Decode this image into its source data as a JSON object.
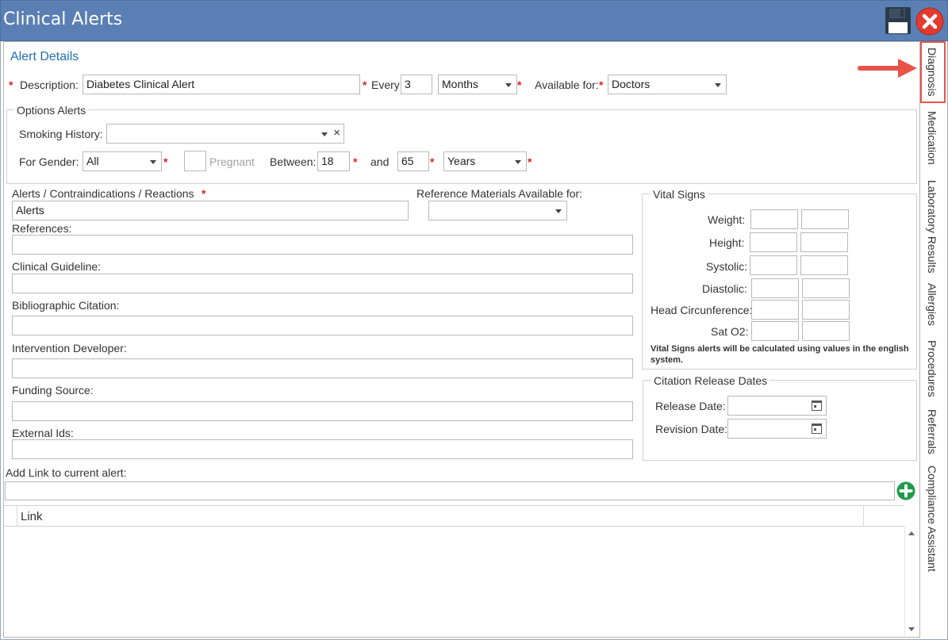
{
  "window": {
    "title": "Clinical Alerts"
  },
  "toolbar": {
    "save_icon": "floppy-disk-icon",
    "close_icon": "red-x-close-icon"
  },
  "side_tabs": [
    {
      "label": "Diagnosis",
      "active": true
    },
    {
      "label": "Medication"
    },
    {
      "label": "Laboratory Results"
    },
    {
      "label": "Allergies"
    },
    {
      "label": "Procedures"
    },
    {
      "label": "Referrals"
    },
    {
      "label": "Compliance Assistant"
    }
  ],
  "alert_details": {
    "section_title": "Alert Details",
    "description_label": "Description:",
    "description_value": "Diabetes Clinical Alert",
    "every_label": "Every:",
    "every_value": "3",
    "every_unit": "Months",
    "available_for_label": "Available for:",
    "available_for_value": "Doctors",
    "required_mark": "*"
  },
  "options_alerts": {
    "legend": "Options Alerts",
    "smoking_label": "Smoking History:",
    "smoking_value": "",
    "clear_symbol": "×",
    "gender_label": "For Gender:",
    "gender_value": "All",
    "pregnant_label": "Pregnant",
    "between_label": "Between:",
    "between_value": "18",
    "and_label": "and",
    "and_value": "65",
    "age_unit": "Years"
  },
  "main_fields": {
    "alerts_label": "Alerts / Contraindications / Reactions",
    "alerts_value": "Alerts",
    "ref_materials_label": "Reference Materials Available for:",
    "ref_materials_value": "",
    "references_label": "References:",
    "clinical_guideline_label": "Clinical Guideline:",
    "bibliographic_label": "Bibliographic Citation:",
    "intervention_label": "Intervention Developer:",
    "funding_label": "Funding Source:",
    "external_ids_label": "External Ids:"
  },
  "vital_signs": {
    "legend": "Vital Signs",
    "rows": [
      {
        "label": "Weight:"
      },
      {
        "label": "Height:"
      },
      {
        "label": "Systolic:"
      },
      {
        "label": "Diastolic:"
      },
      {
        "label": "Head Circunference:"
      },
      {
        "label": "Sat O2:"
      }
    ],
    "note": "Vital Signs alerts will be calculated using values in the english system."
  },
  "citation_dates": {
    "legend": "Citation Release Dates",
    "release_label": "Release Date:",
    "revision_label": "Revision Date:"
  },
  "link_section": {
    "label": "Add Link to current alert:",
    "add_icon": "green-plus-circle-icon",
    "grid_header": "Link"
  },
  "colors": {
    "titlebar": "#5a7fb5",
    "accent_text": "#1f6fb8",
    "required": "#e02020",
    "highlight_arrow": "#e8534a"
  }
}
